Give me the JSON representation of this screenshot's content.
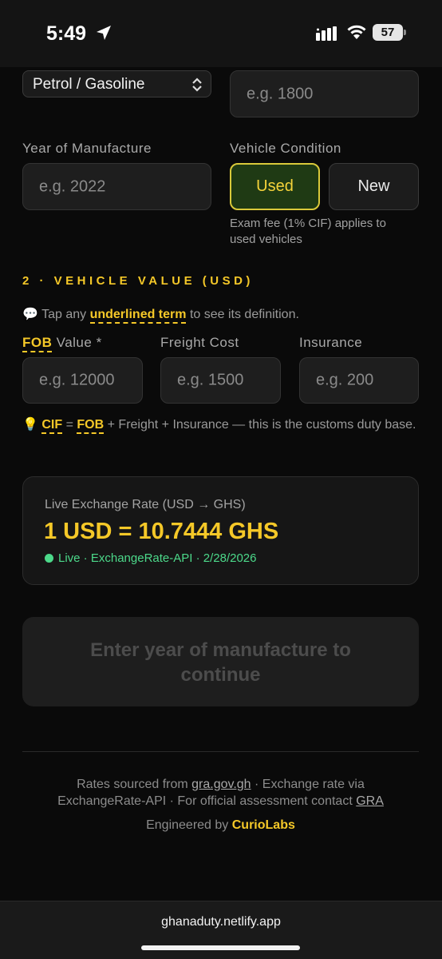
{
  "status_bar": {
    "time": "5:49",
    "battery": "57"
  },
  "form": {
    "fuel_type": "Petrol / Gasoline",
    "engine_placeholder": "e.g. 1800",
    "year_label": "Year of Manufacture",
    "year_placeholder": "e.g. 2022",
    "condition_label": "Vehicle Condition",
    "condition_used": "Used",
    "condition_new": "New",
    "condition_selected": "Used",
    "exam_fee_note_1": "Exam fee (1% CIF) applies to",
    "exam_fee_note_2": "used vehicles"
  },
  "section2": {
    "title": "2 · VEHICLE VALUE (USD)",
    "hint_icon": "💬",
    "hint_pre": "Tap any",
    "hint_term": "underlined term",
    "hint_post": "to see its definition.",
    "fob_term": "FOB",
    "fob_label_rest": "Value *",
    "freight_label": "Freight Cost",
    "insurance_label": "Insurance",
    "fob_placeholder": "e.g. 12000",
    "freight_placeholder": "e.g. 1500",
    "insurance_placeholder": "e.g. 200",
    "formula_icon": "💡",
    "formula_cif": "CIF",
    "formula_eq": "=",
    "formula_fob": "FOB",
    "formula_rest": "+ Freight + Insurance — this is the customs",
    "formula_rest2": "duty base."
  },
  "exchange": {
    "label": "Live Exchange Rate (USD → GHS)",
    "value": "1 USD = 10.7444 GHS",
    "status": "Live · ExchangeRate-API · 2/28/2026"
  },
  "continue_button": {
    "line1": "Enter year of manufacture to",
    "line2": "continue"
  },
  "footer": {
    "pre1": "Rates sourced from",
    "link1": "gra.gov.gh",
    "mid1": "· Exchange rate via",
    "line2": "ExchangeRate-API · For official assessment contact",
    "link2": "GRA",
    "engineered": "Engineered by",
    "brand": "CurioLabs"
  },
  "browser": {
    "url": "ghanaduty.netlify.app"
  },
  "colors": {
    "accent": "#f5c828",
    "live": "#4cd98a",
    "background": "#0a0a0a"
  }
}
